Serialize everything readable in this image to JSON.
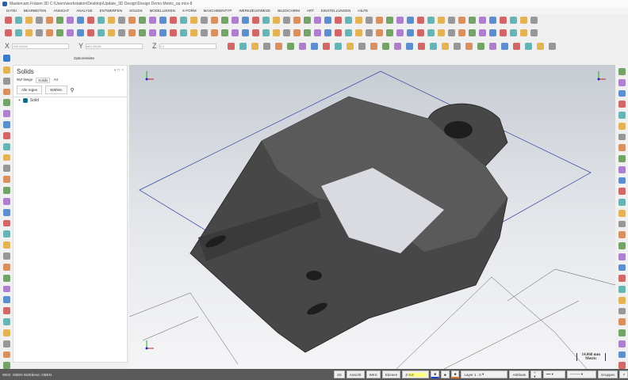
{
  "window": {
    "title": "Mastercam Fräsen 3D  C:\\Users\\workstation\\Desktop\\Update_3D Design\\Design Demo Metric_op.mcx-8"
  },
  "menu": [
    "DATEI",
    "BEARBEITEN",
    "ANSICHT",
    "ANALYSE",
    "ENTWERFEN",
    "SOLIDS",
    "MODELLIEREN",
    "X-FORM",
    "MASCHINENTYP",
    "WERKZEUGWEGE",
    "BILDSCHIRM",
    "ART",
    "EINSTELLUNGEN",
    "HILFE"
  ],
  "coords": {
    "x_label": "X",
    "x_value": "198.41004",
    "y_label": "Y",
    "y_value": "463.20081",
    "z_label": "Z",
    "z_value": "0.0"
  },
  "optionsbar": "Optionsleiste",
  "panel": {
    "title": "Solids",
    "tabs": [
      "WZ-Wege",
      "Solids",
      "Art"
    ],
    "buttons": [
      "Alle regen",
      "Wählen"
    ],
    "tree_item": "Solid"
  },
  "viewport": {
    "scale_value": "14.068 mm",
    "scale_unit": "Metric"
  },
  "status": {
    "left": "WKS: OBEN  WZEbene: OBEN",
    "buttons": [
      "2D",
      "Ansicht",
      "WKS",
      "Ebenen"
    ],
    "z_label": "Z",
    "z_value": "0.0",
    "layer_label": "Layer",
    "layer_value": "1 : 0",
    "attribute": "Attribute",
    "groups": "Gruppen",
    "help": "?"
  },
  "colors": {
    "accent": "#1a6fc4",
    "model": "#4a4a4a",
    "status_bg": "#5a5a5a"
  }
}
